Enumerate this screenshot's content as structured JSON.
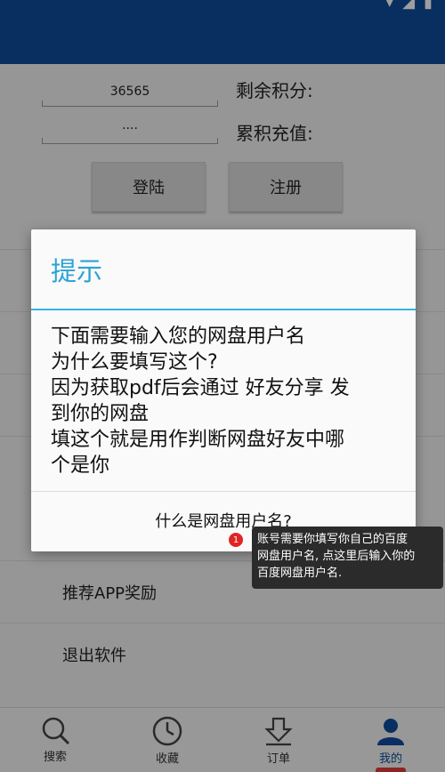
{
  "form": {
    "field_1_value": "36565",
    "field_2_value": "····",
    "label_1": "剩余积分:",
    "label_2": "累积充值:",
    "login_label": "登陆",
    "register_label": "注册"
  },
  "menu": {
    "items": [
      "",
      "",
      "",
      "",
      "推荐APP奖励",
      "退出软件"
    ]
  },
  "nav": {
    "items": [
      {
        "label": "搜索",
        "icon": "search-icon"
      },
      {
        "label": "收藏",
        "icon": "clock-icon"
      },
      {
        "label": "订单",
        "icon": "download-icon"
      },
      {
        "label": "我的",
        "icon": "user-icon"
      }
    ],
    "active_color": "#0d4c9b",
    "underline_color": "#e23b3b"
  },
  "dialog": {
    "title": "提示",
    "body_lines": [
      "下面需要输入您的网盘用户名",
      "为什么要填写这个?",
      "因为获取pdf后会通过 好友分享 发",
      "到你的网盘",
      "填这个就是用作判断网盘好友中哪",
      "个是你"
    ],
    "action_label": "什么是网盘用户名?",
    "title_color": "#2aa3d6"
  },
  "tooltip": {
    "badge": "1",
    "text_lines": [
      "账号需要你填写你自己的百度",
      "网盘用户名, 点这里后输入你的",
      "百度网盘用户名."
    ]
  },
  "colors": {
    "appbar": "#0d4c9b"
  }
}
